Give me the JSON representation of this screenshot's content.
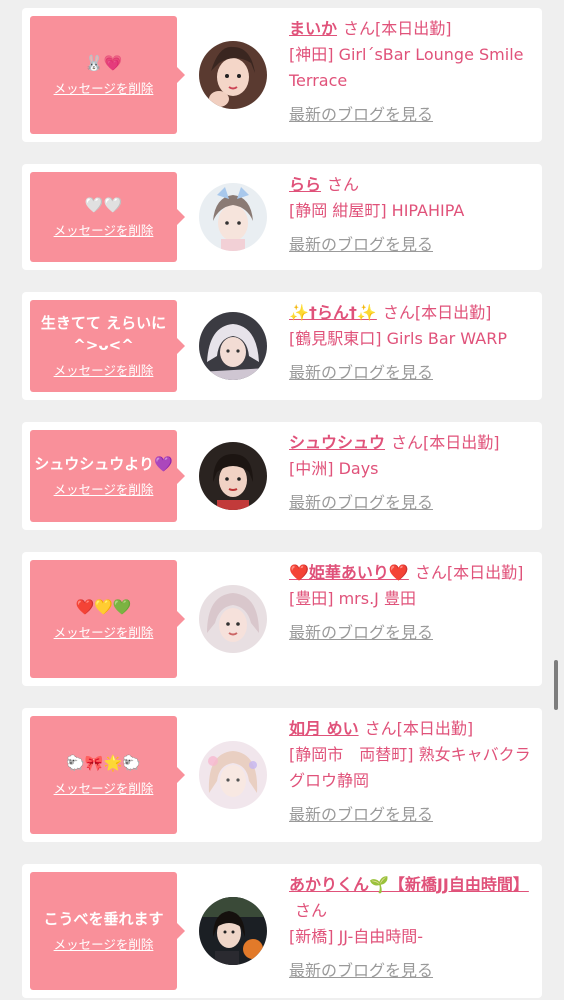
{
  "delete_label": "メッセージを削除",
  "blog_label": "最新のブログを見る",
  "san_label": "さん",
  "colors": {
    "bubble": "#f9909a",
    "accent": "#e0527a",
    "link_gray": "#9a9a9a"
  },
  "messages": [
    {
      "message": "🐰💗",
      "name": "まいか",
      "status": "[本日出勤]",
      "shop": "[神田] Girl´sBar Lounge Smile Terrace",
      "avatar": "profile-photo-maika"
    },
    {
      "message": "🤍🤍",
      "name": "らら",
      "status": "",
      "shop": "[静岡 紺屋町] HIPAHIPA",
      "avatar": "profile-photo-rara"
    },
    {
      "message": "生きてて えらいに^>ᴗ<^",
      "name": "✨†らん†✨",
      "status": "[本日出勤]",
      "shop": "[鶴見駅東口] Girls Bar WARP",
      "avatar": "profile-photo-ran"
    },
    {
      "message": "シュウシュウより💜",
      "name": "シュウシュウ",
      "status": "[本日出勤]",
      "shop": "[中洲] Days",
      "avatar": "profile-photo-shushu"
    },
    {
      "message": "❤️💛💚",
      "name": "❤️姫華あいり❤️",
      "status": "[本日出勤]",
      "shop": "[豊田] mrs.J 豊田",
      "avatar": "profile-photo-airi"
    },
    {
      "message": "🐑🎀🌟🐑",
      "name": "如月 めい",
      "status": "[本日出勤]",
      "shop": "[静岡市　両替町] 熟女キャバクラ グロウ静岡",
      "avatar": "profile-photo-mei"
    },
    {
      "message": "こうべを垂れます",
      "name": "あかりくん🌱【新橋JJ自由時間】",
      "status": "",
      "shop": "[新橋] JJ-自由時間-",
      "avatar": "profile-photo-akari"
    }
  ]
}
